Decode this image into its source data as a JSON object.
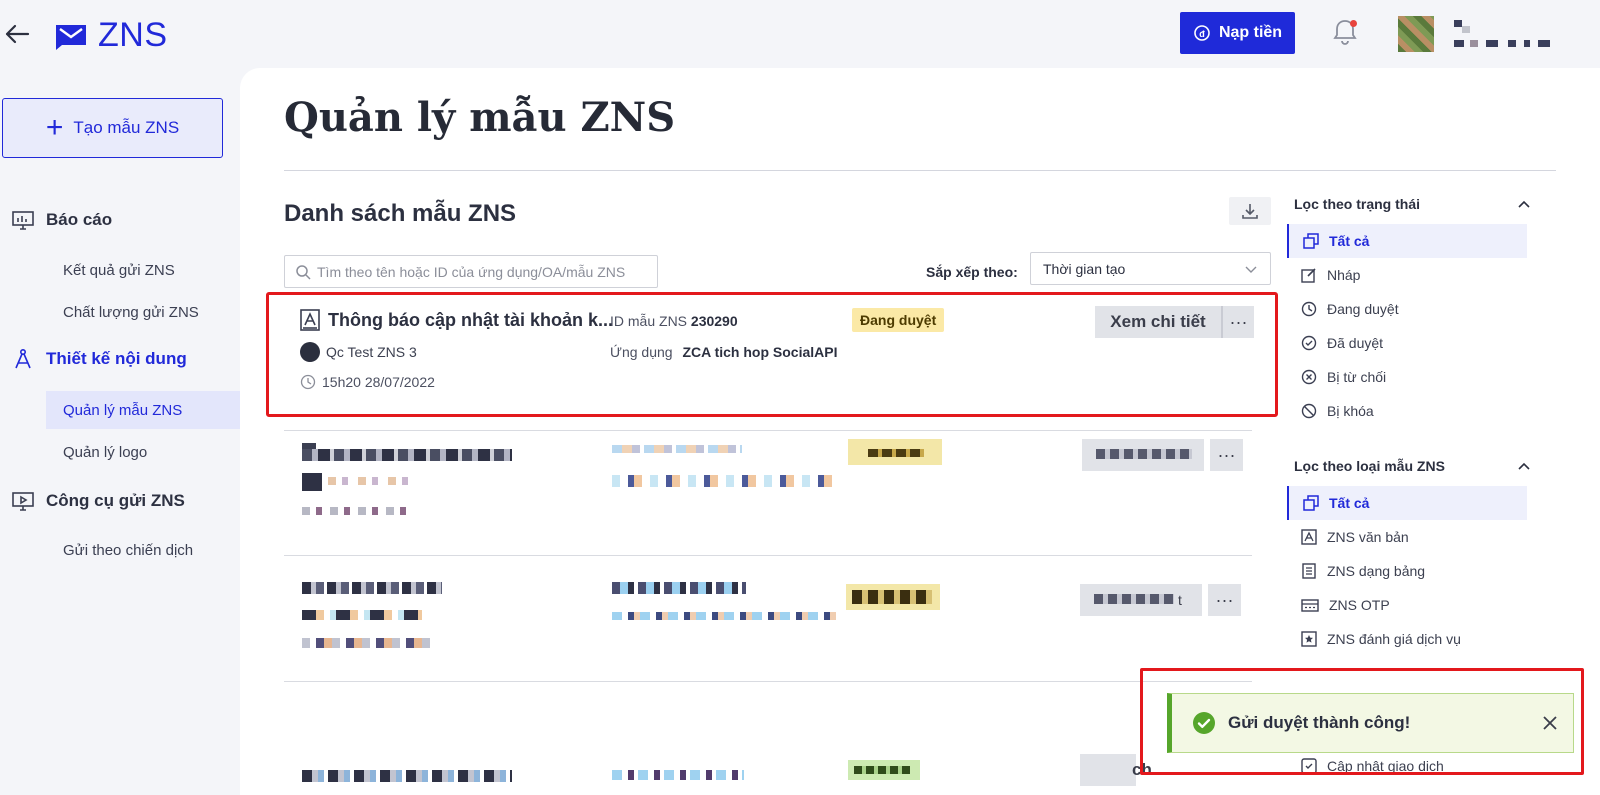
{
  "header": {
    "logo_text": "ZNS",
    "topup_label": "Nạp tiền",
    "accent_color": "#2129d9"
  },
  "sidebar": {
    "create_label": "Tạo mẫu ZNS",
    "groups": [
      {
        "label": "Báo cáo",
        "icon": "monitor-chart-icon",
        "items": [
          "Kết quả gửi ZNS",
          "Chất lượng gửi ZNS"
        ]
      },
      {
        "label": "Thiết kế nội dung",
        "icon": "compass-icon",
        "items": [
          "Quản lý mẫu ZNS",
          "Quản lý logo"
        ]
      },
      {
        "label": "Công cụ gửi ZNS",
        "icon": "screen-send-icon",
        "items": [
          "Gửi theo chiến dịch"
        ]
      }
    ],
    "active_item": "Quản lý mẫu ZNS"
  },
  "main": {
    "page_title": "Quản lý mẫu ZNS",
    "list_title": "Danh sách mẫu ZNS",
    "search_placeholder": "Tìm theo tên hoặc ID của ứng dụng/OA/mẫu ZNS",
    "sort_label": "Sắp xếp theo:",
    "sort_value": "Thời gian tạo"
  },
  "template": {
    "name": "Thông báo cập nhật tài khoản k...",
    "id_label": "ID mẫu ZNS",
    "id_value": "230290",
    "status": "Đang duyệt",
    "owner": "Qc Test ZNS 3",
    "app_label": "Ứng dụng",
    "app_value": "ZCA tich hop SocialAPI",
    "created": "15h20 28/07/2022",
    "detail_label": "Xem chi tiết",
    "more_label": "···"
  },
  "partial_texts": {
    "row2_button_tail": "t",
    "row3_button_tail": "ch"
  },
  "filters": {
    "status_title": "Lọc theo trạng thái",
    "status_items": [
      {
        "label": "Tất cả",
        "icon": "copy-icon"
      },
      {
        "label": "Nháp",
        "icon": "edit-icon"
      },
      {
        "label": "Đang duyệt",
        "icon": "clock-icon"
      },
      {
        "label": "Đã duyệt",
        "icon": "check-circle-icon"
      },
      {
        "label": "Bị từ chối",
        "icon": "x-circle-icon"
      },
      {
        "label": "Bị khóa",
        "icon": "ban-icon"
      }
    ],
    "type_title": "Lọc theo loại mẫu ZNS",
    "type_items": [
      {
        "label": "Tất cả",
        "icon": "copy-icon"
      },
      {
        "label": "ZNS văn bản",
        "icon": "text-box-icon"
      },
      {
        "label": "ZNS dạng bảng",
        "icon": "table-icon"
      },
      {
        "label": "ZNS OTP",
        "icon": "otp-icon"
      },
      {
        "label": "ZNS đánh giá dịch vụ",
        "icon": "star-box-icon"
      },
      {
        "label": "Cập nhật giao dịch",
        "icon": "transaction-icon"
      }
    ]
  },
  "toast": {
    "message": "Gửi duyệt thành công!",
    "color": "#56a62b"
  }
}
